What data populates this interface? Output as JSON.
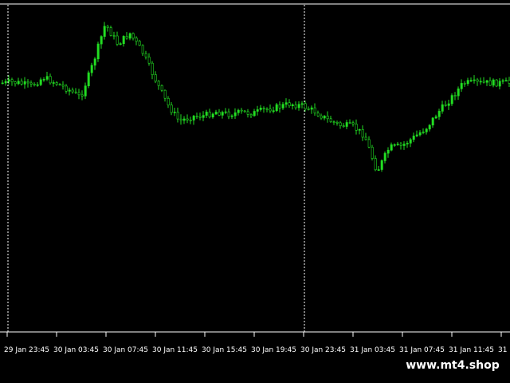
{
  "chart_data": {
    "type": "candlestick",
    "title": "",
    "xlabel": "",
    "ylabel": "",
    "grid": false,
    "colors": {
      "background": "#000000",
      "candle": "#22dd22",
      "separator": "#ffffff",
      "axis": "#ffffff"
    },
    "x_tick_labels": [
      "29 Jan 23:45",
      "30 Jan 03:45",
      "30 Jan 07:45",
      "30 Jan 11:45",
      "30 Jan 15:45",
      "30 Jan 19:45",
      "30 Jan 23:45",
      "31 Jan 03:45",
      "31 Jan 07:45",
      "31 Jan 11:45",
      "31"
    ],
    "day_separators": [
      "29 Jan 23:45",
      "30 Jan 23:45"
    ],
    "price_path": [
      [
        "29 Jan 23:45",
        103
      ],
      [
        "30 Jan 00:45",
        104
      ],
      [
        "30 Jan 01:45",
        108
      ],
      [
        "30 Jan 02:45",
        97
      ],
      [
        "30 Jan 03:45",
        104
      ],
      [
        "30 Jan 04:45",
        112
      ],
      [
        "30 Jan 05:45",
        122
      ],
      [
        "30 Jan 06:45",
        80
      ],
      [
        "30 Jan 07:45",
        30
      ],
      [
        "30 Jan 08:45",
        55
      ],
      [
        "30 Jan 09:45",
        42
      ],
      [
        "30 Jan 10:45",
        65
      ],
      [
        "30 Jan 11:45",
        98
      ],
      [
        "30 Jan 12:45",
        130
      ],
      [
        "30 Jan 13:45",
        152
      ],
      [
        "30 Jan 14:45",
        146
      ],
      [
        "30 Jan 15:45",
        145
      ],
      [
        "30 Jan 16:45",
        140
      ],
      [
        "30 Jan 17:45",
        143
      ],
      [
        "30 Jan 18:45",
        141
      ],
      [
        "30 Jan 19:45",
        142
      ],
      [
        "30 Jan 20:45",
        137
      ],
      [
        "30 Jan 21:45",
        134
      ],
      [
        "30 Jan 22:45",
        130
      ],
      [
        "30 Jan 23:45",
        133
      ],
      [
        "31 Jan 00:45",
        140
      ],
      [
        "31 Jan 01:45",
        150
      ],
      [
        "31 Jan 02:45",
        157
      ],
      [
        "31 Jan 03:45",
        158
      ],
      [
        "31 Jan 04:45",
        170
      ],
      [
        "31 Jan 05:45",
        215
      ],
      [
        "31 Jan 06:45",
        185
      ],
      [
        "31 Jan 07:45",
        183
      ],
      [
        "31 Jan 08:45",
        172
      ],
      [
        "31 Jan 09:45",
        160
      ],
      [
        "31 Jan 10:45",
        140
      ],
      [
        "31 Jan 11:45",
        123
      ],
      [
        "31 Jan 12:45",
        104
      ]
    ]
  },
  "watermark": "www.mt4.shop"
}
